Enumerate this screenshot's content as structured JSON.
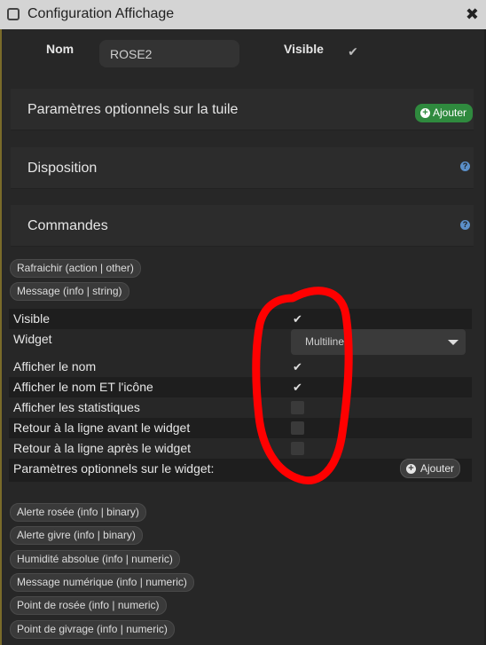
{
  "window": {
    "title": "Configuration Affichage",
    "close_glyph": "✖"
  },
  "nom_row": {
    "label": "Nom",
    "value": "ROSE2",
    "visible_label": "Visible",
    "visible_checked": true
  },
  "panels": {
    "tile_optional": {
      "title": "Paramètres optionnels sur la tuile",
      "add_label": "Ajouter"
    },
    "layout": {
      "title": "Disposition",
      "help": "?"
    },
    "commands": {
      "title": "Commandes",
      "help": "?"
    }
  },
  "top_commands": [
    "Rafraichir (action | other)",
    "Message (info | string)"
  ],
  "command_config": {
    "rows": [
      {
        "label": "Visible",
        "checked": true
      },
      {
        "label": "Widget",
        "select_value": "Multiline"
      },
      {
        "label": "Afficher le nom",
        "checked": true
      },
      {
        "label": "Afficher le nom ET l'icône",
        "checked": true
      },
      {
        "label": "Afficher les statistiques",
        "checked": false
      },
      {
        "label": "Retour à la ligne avant le widget",
        "checked": false
      },
      {
        "label": "Retour à la ligne après le widget",
        "checked": false
      },
      {
        "label": "Paramètres optionnels sur le widget:",
        "add_label": "Ajouter"
      }
    ]
  },
  "other_commands": [
    "Alerte rosée (info | binary)",
    "Alerte givre (info | binary)",
    "Humidité absolue (info | numeric)",
    "Message numérique (info | numeric)",
    "Point de rosée (info | numeric)",
    "Point de givrage (info | numeric)"
  ],
  "icons": {
    "check": "✔",
    "plus": "+",
    "help": "question-circle-icon",
    "caret": "caret-down-icon"
  },
  "colors": {
    "add_button": "#2f8a3e",
    "help_icon": "#5b8fc8",
    "annotation": "#ff0000"
  }
}
